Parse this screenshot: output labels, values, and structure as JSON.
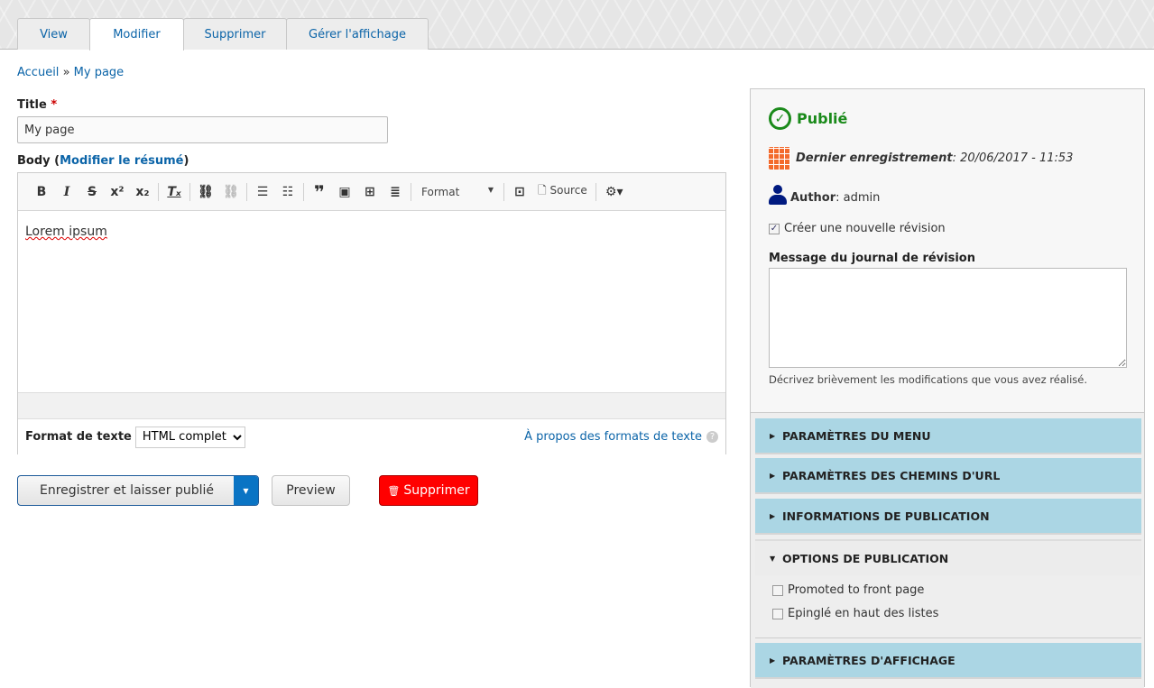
{
  "tabs": [
    {
      "label": "View"
    },
    {
      "label": "Modifier",
      "active": true
    },
    {
      "label": "Supprimer"
    },
    {
      "label": "Gérer l'affichage"
    }
  ],
  "breadcrumb": {
    "home": "Accueil",
    "sep": "»",
    "current": "My page"
  },
  "form": {
    "title_label": "Title",
    "required_mark": "*",
    "title_value": "My page",
    "body_label": "Body (",
    "body_link": "Modifier le résumé",
    "body_close": ")",
    "toolbar": {
      "format_label": "Format",
      "source_label": "Source"
    },
    "content": "Lorem ipsum",
    "text_format_label": "Format de texte",
    "text_format_value": "HTML complet",
    "about_formats": "À propos des formats de texte"
  },
  "actions": {
    "save": "Enregistrer et laisser publié",
    "preview": "Preview",
    "delete": "Supprimer"
  },
  "sidebar": {
    "status": "Publié",
    "status_color": "#1a8a1a",
    "last_saved_label": "Dernier enregistrement",
    "last_saved_value": ": 20/06/2017 - 11:53",
    "author_label": "Author",
    "author_value": ": admin",
    "new_revision": "Créer une nouvelle révision",
    "new_revision_checked": true,
    "log_label": "Message du journal de révision",
    "log_value": "",
    "log_help": "Décrivez brièvement les modifications que vous avez réalisé.",
    "sections": [
      {
        "label": "PARAMÈTRES DU MENU",
        "expanded": false
      },
      {
        "label": "PARAMÈTRES DES CHEMINS D'URL",
        "expanded": false
      },
      {
        "label": "INFORMATIONS DE PUBLICATION",
        "expanded": false
      },
      {
        "label": "OPTIONS DE PUBLICATION",
        "expanded": true
      },
      {
        "label": "PARAMÈTRES D'AFFICHAGE",
        "expanded": false
      }
    ],
    "options": [
      {
        "label": "Promoted to front page",
        "checked": false
      },
      {
        "label": "Epinglé en haut des listes",
        "checked": false
      }
    ]
  }
}
